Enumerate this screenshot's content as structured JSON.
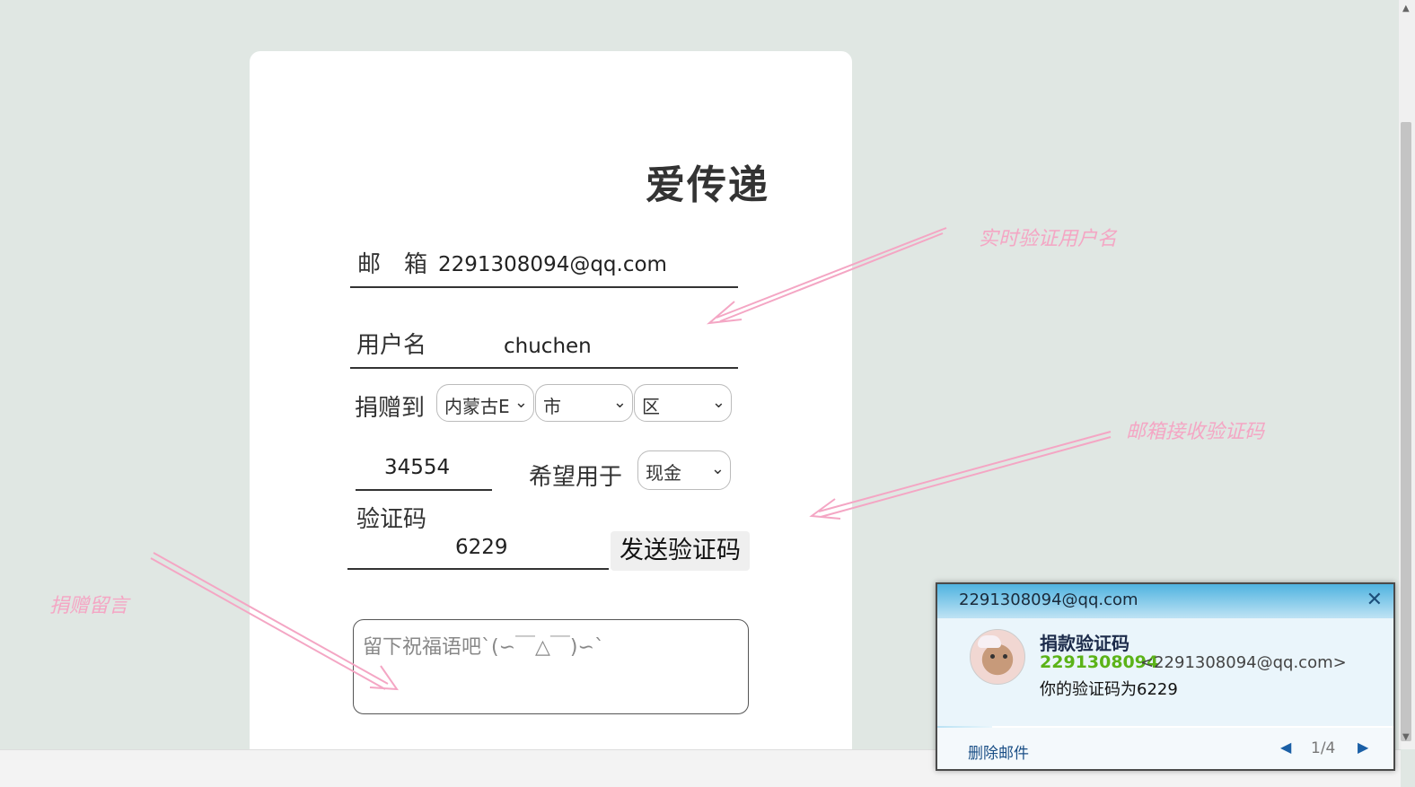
{
  "form": {
    "title": "爱传递",
    "email_label": "邮　箱",
    "email_value": "2291308094@qq.com",
    "username_label": "用户名",
    "username_value": "chuchen",
    "donate_label": "捐赠到",
    "province": "内蒙古E",
    "city": "市",
    "district": "区",
    "amount_value": "34554",
    "usage_label": "希望用于",
    "usage": "现金",
    "code_label": "验证码",
    "code_value": "6229",
    "send_button": "发送验证码",
    "message_placeholder": "留下祝福语吧`(∽￣△￣)∽`"
  },
  "annotations": {
    "realtime_username": "实时验证用户名",
    "email_code": "邮箱接收验证码",
    "donation_message": "捐赠留言"
  },
  "notification": {
    "account": "2291308094@qq.com",
    "close_glyph": "✕",
    "subject": "捐款验证码",
    "sender_name": "2291308094",
    "sender_address": "<2291308094@qq.com>",
    "body": "你的验证码为6229",
    "delete_label": "删除邮件",
    "page": "1/4",
    "progress_fraction": 0.12
  },
  "colors": {
    "page_background": "#e0e7e3",
    "annotation": "#f4a6c4",
    "sender_green": "#5bb318"
  }
}
